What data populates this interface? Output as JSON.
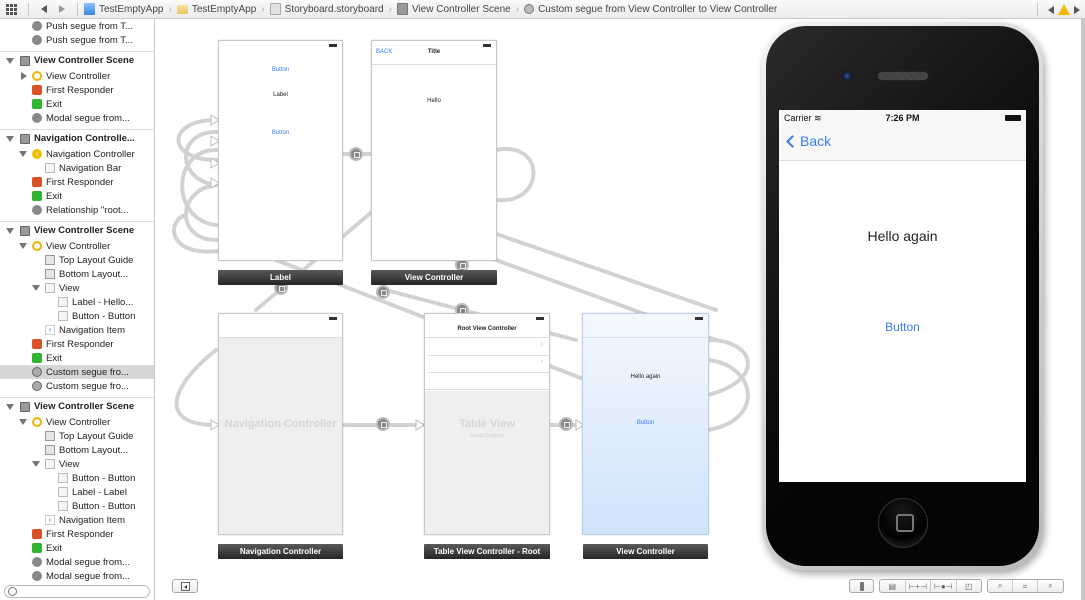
{
  "jumpbar": {
    "crumbs": [
      {
        "label": "TestEmptyApp",
        "icon": "project-icon"
      },
      {
        "label": "TestEmptyApp",
        "icon": "folder-icon"
      },
      {
        "label": "Storyboard.storyboard",
        "icon": "storyboard-icon"
      },
      {
        "label": "View Controller Scene",
        "icon": "scene-icon"
      },
      {
        "label": "Custom segue from View Controller to View Controller",
        "icon": "segue-icon"
      }
    ]
  },
  "outline": {
    "rows": [
      {
        "label": "Push segue from T...",
        "icon": "segue",
        "indent": 1
      },
      {
        "label": "Push segue from T...",
        "icon": "segue",
        "indent": 1
      },
      {
        "label": "View Controller Scene",
        "icon": "scene",
        "indent": 0,
        "scene": true,
        "tri": "down"
      },
      {
        "label": "View Controller",
        "icon": "vc",
        "indent": 1,
        "tri": "right"
      },
      {
        "label": "First Responder",
        "icon": "fr",
        "indent": 1
      },
      {
        "label": "Exit",
        "icon": "exit",
        "indent": 1
      },
      {
        "label": "Modal segue from...",
        "icon": "segue",
        "indent": 1
      },
      {
        "label": "Navigation Controlle...",
        "icon": "scene",
        "indent": 0,
        "scene": true,
        "tri": "down"
      },
      {
        "label": "Navigation Controller",
        "icon": "nav",
        "indent": 1,
        "tri": "down"
      },
      {
        "label": "Navigation Bar",
        "icon": "box",
        "indent": 2
      },
      {
        "label": "First Responder",
        "icon": "fr",
        "indent": 1
      },
      {
        "label": "Exit",
        "icon": "exit",
        "indent": 1
      },
      {
        "label": "Relationship \"root...",
        "icon": "segue",
        "indent": 1
      },
      {
        "label": "View Controller Scene",
        "icon": "scene",
        "indent": 0,
        "scene": true,
        "tri": "down"
      },
      {
        "label": "View Controller",
        "icon": "vc",
        "indent": 1,
        "tri": "down"
      },
      {
        "label": "Top Layout Guide",
        "icon": "guide",
        "indent": 2
      },
      {
        "label": "Bottom Layout...",
        "icon": "guide",
        "indent": 2
      },
      {
        "label": "View",
        "icon": "box",
        "indent": 2,
        "tri": "down"
      },
      {
        "label": "Label - Hello...",
        "icon": "box",
        "indent": 3
      },
      {
        "label": "Button - Button",
        "icon": "box",
        "indent": 3
      },
      {
        "label": "Navigation Item",
        "icon": "navitem",
        "indent": 2
      },
      {
        "label": "First Responder",
        "icon": "fr",
        "indent": 1
      },
      {
        "label": "Exit",
        "icon": "exit",
        "indent": 1
      },
      {
        "label": "Custom segue fro...",
        "icon": "custom",
        "indent": 1,
        "selected": true
      },
      {
        "label": "Custom segue fro...",
        "icon": "custom",
        "indent": 1
      },
      {
        "label": "View Controller Scene",
        "icon": "scene",
        "indent": 0,
        "scene": true,
        "tri": "down"
      },
      {
        "label": "View Controller",
        "icon": "vc",
        "indent": 1,
        "tri": "down"
      },
      {
        "label": "Top Layout Guide",
        "icon": "guide",
        "indent": 2
      },
      {
        "label": "Bottom Layout...",
        "icon": "guide",
        "indent": 2
      },
      {
        "label": "View",
        "icon": "box",
        "indent": 2,
        "tri": "down"
      },
      {
        "label": "Button - Button",
        "icon": "box",
        "indent": 3
      },
      {
        "label": "Label - Label",
        "icon": "box",
        "indent": 3
      },
      {
        "label": "Button - Button",
        "icon": "box",
        "indent": 3
      },
      {
        "label": "Navigation Item",
        "icon": "navitem",
        "indent": 2
      },
      {
        "label": "First Responder",
        "icon": "fr",
        "indent": 1
      },
      {
        "label": "Exit",
        "icon": "exit",
        "indent": 1
      },
      {
        "label": "Modal segue from...",
        "icon": "segue",
        "indent": 1
      },
      {
        "label": "Modal segue from...",
        "icon": "segue",
        "indent": 1
      }
    ],
    "filter_placeholder": ""
  },
  "canvas": {
    "scenes": {
      "vc1": {
        "label": "Label",
        "button_top": "Button",
        "button_bottom": "Button"
      },
      "vc2": {
        "label": "View Controller",
        "back": "BACK",
        "title": "Title",
        "text": "Hello"
      },
      "nav": {
        "label": "Navigation Controller",
        "placeholder": "Navigation Controller"
      },
      "table": {
        "label": "Table View Controller - Root",
        "title": "Root View Controller",
        "placeholder": "Table View",
        "sub": "Static Content"
      },
      "vc3": {
        "label": "View Controller",
        "text": "Hello again",
        "button": "Button"
      }
    }
  },
  "device": {
    "carrier": "Carrier",
    "time": "7:26 PM",
    "back": "Back",
    "hello": "Hello again",
    "button": "Button"
  },
  "colors": {
    "accent": "#3a7bf0",
    "warning": "#f5b800",
    "selection": "#d6d6d6"
  }
}
